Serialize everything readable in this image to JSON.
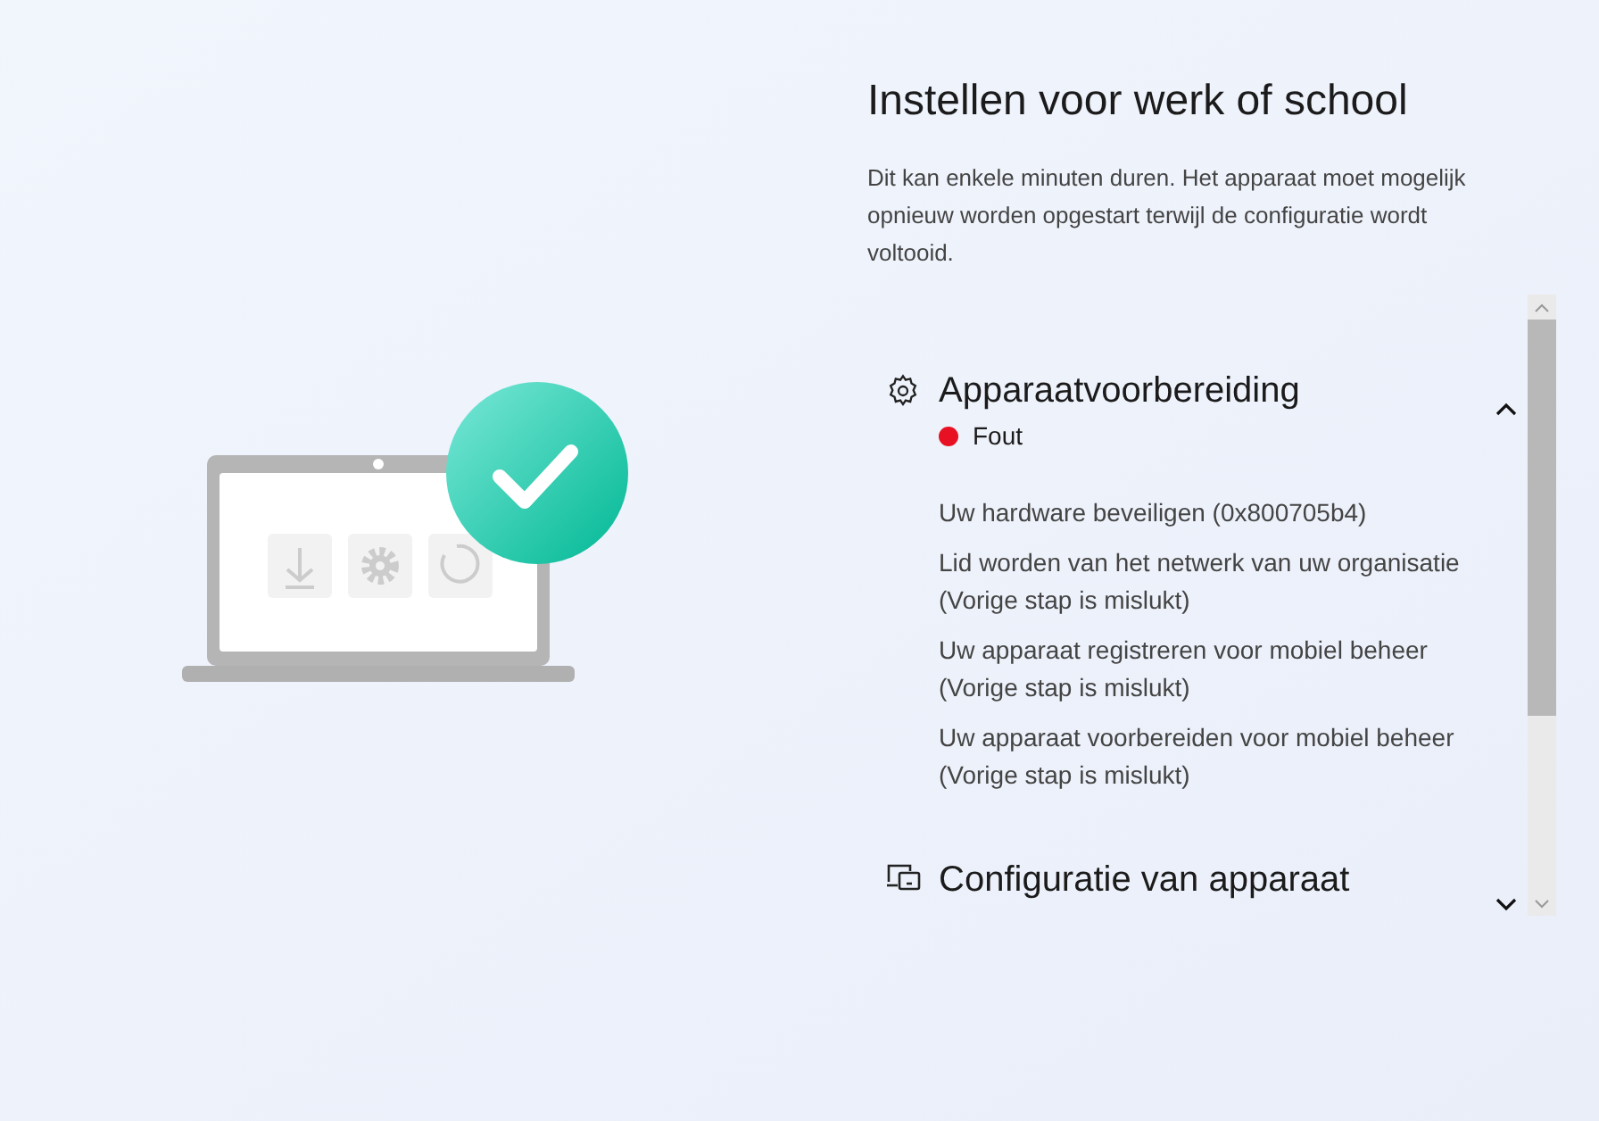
{
  "title": "Instellen voor werk of school",
  "description": "Dit kan enkele minuten duren. Het apparaat moet mogelijk opnieuw worden opgestart terwijl de configuratie wordt voltooid.",
  "sections": [
    {
      "kind": "gear",
      "title": "Apparaatvoorbereiding",
      "expanded": true,
      "status": {
        "label": "Fout",
        "color": "#e81123"
      },
      "steps": [
        {
          "text": "Uw hardware beveiligen (0x800705b4)"
        },
        {
          "text": "Lid worden van het netwerk van uw organisatie",
          "note": "(Vorige stap is mislukt)"
        },
        {
          "text": "Uw apparaat registreren voor mobiel beheer",
          "note": "(Vorige stap is mislukt)"
        },
        {
          "text": "Uw apparaat voorbereiden voor mobiel beheer",
          "note": "(Vorige stap is mislukt)"
        }
      ]
    },
    {
      "kind": "devices",
      "title": "Configuratie van apparaat",
      "expanded": false
    }
  ]
}
